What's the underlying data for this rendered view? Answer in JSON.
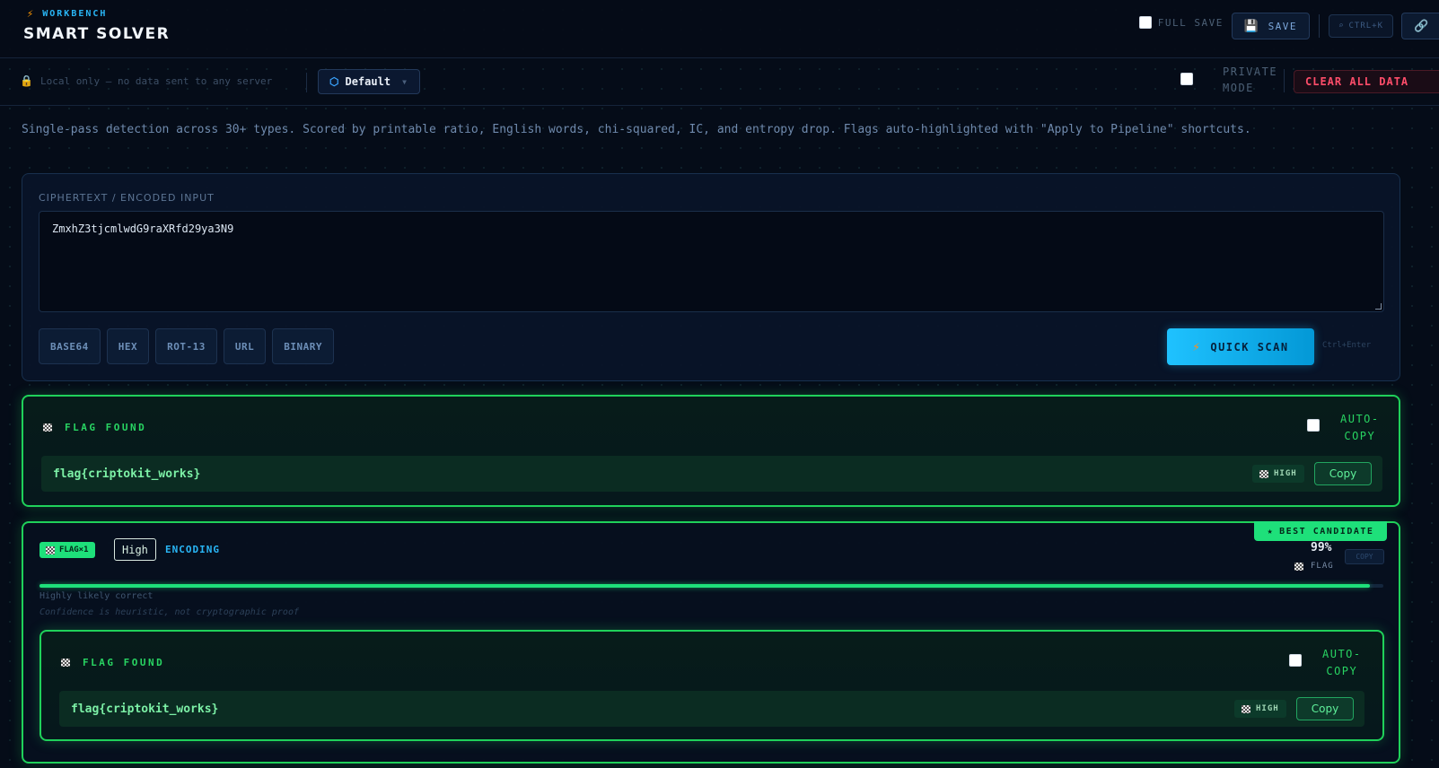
{
  "header": {
    "eyebrow": "WORKBENCH",
    "title": "SMART SOLVER",
    "full_save_label": "FULL SAVE",
    "save_label": "SAVE",
    "shortcut_label": "CTRL+K"
  },
  "subbar": {
    "local_notice": "Local only — no data sent to any server",
    "profile": "Default",
    "private_mode_line1": "PRIVATE",
    "private_mode_line2": "MODE",
    "clear_all_label": "CLEAR ALL DATA"
  },
  "description": "Single-pass detection across 30+ types. Scored by printable ratio, English words, chi-squared, IC, and entropy drop. Flags auto-highlighted with \"Apply to Pipeline\" shortcuts.",
  "input": {
    "label": "CIPHERTEXT / ENCODED INPUT",
    "value": "ZmxhZ3tjcmlwdG9raXRfd29ya3N9",
    "chips": [
      "BASE64",
      "HEX",
      "ROT-13",
      "URL",
      "BINARY"
    ],
    "scan_label": "QUICK SCAN",
    "scan_hint": "Ctrl+Enter"
  },
  "flag_banner": {
    "title": "FLAG FOUND",
    "auto_copy_line1": "AUTO-",
    "auto_copy_line2": "COPY",
    "flag": "flag{criptokit_works}",
    "confidence": "HIGH",
    "copy_label": "Copy"
  },
  "result": {
    "best_label": "BEST CANDIDATE",
    "flag_count_tag": "FLAG×1",
    "confidence_tag": "High",
    "category": "ENCODING",
    "score_text": "99%",
    "score_value": 0.99,
    "flag_marker": "FLAG",
    "copy_label": "COPY",
    "verdict": "Highly likely correct",
    "disclaimer": "Confidence is heuristic, not cryptographic proof",
    "nested": {
      "title": "FLAG FOUND",
      "auto_copy_line1": "AUTO-",
      "auto_copy_line2": "COPY",
      "flag": "flag{criptokit_works}",
      "confidence": "HIGH",
      "copy_label": "Copy"
    }
  },
  "icons": {
    "bolt": "bolt-icon",
    "save": "floppy-icon",
    "search": "search-icon",
    "link": "link-icon",
    "lock": "lock-icon",
    "profile": "hexagon-icon",
    "flag": "checkered-flag-icon",
    "star": "star-icon"
  },
  "colors": {
    "accent_cyan": "#29b6f6",
    "flag_green": "#1fd15a",
    "danger": "#ff4d6a",
    "background": "#050c18"
  }
}
